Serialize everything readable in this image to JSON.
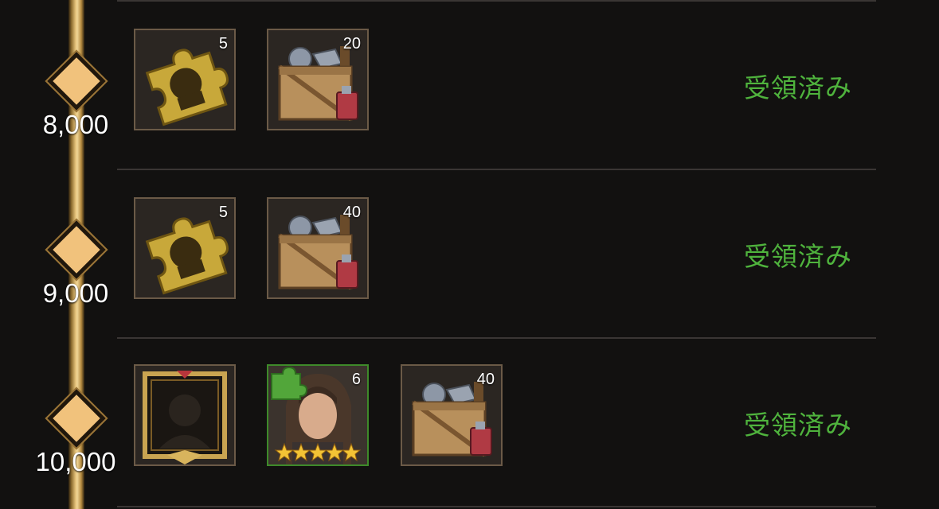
{
  "tiers": [
    {
      "threshold": "8,000",
      "status": "受領済み",
      "rewards": [
        {
          "icon": "puzzle-piece-icon",
          "qty": "5"
        },
        {
          "icon": "supply-crate-icon",
          "qty": "20"
        }
      ]
    },
    {
      "threshold": "9,000",
      "status": "受領済み",
      "rewards": [
        {
          "icon": "puzzle-piece-icon",
          "qty": "5"
        },
        {
          "icon": "supply-crate-icon",
          "qty": "40"
        }
      ]
    },
    {
      "threshold": "10,000",
      "status": "受領済み",
      "rewards": [
        {
          "icon": "avatar-frame-icon",
          "qty": ""
        },
        {
          "icon": "hero-fragment-icon",
          "qty": "6",
          "stars": 5
        },
        {
          "icon": "supply-crate-icon",
          "qty": "40"
        }
      ]
    }
  ],
  "colors": {
    "claimed_text": "#4fb33d",
    "track_gold": "#e7c47c",
    "hero_border": "#3e8a2a"
  }
}
